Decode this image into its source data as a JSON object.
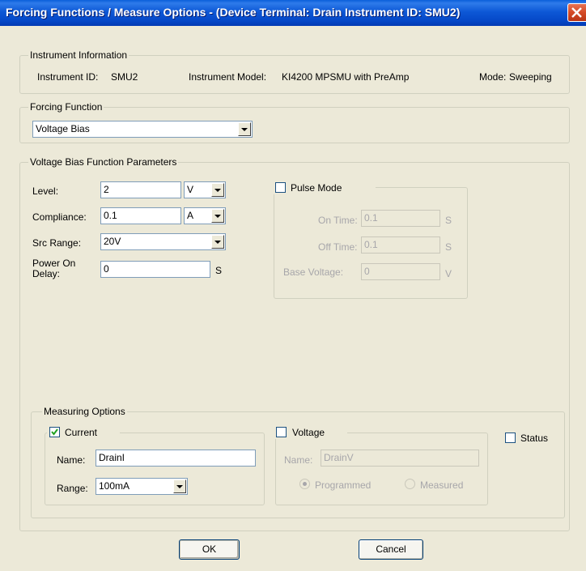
{
  "window": {
    "title": "Forcing Functions / Measure Options - (Device Terminal: Drain  Instrument ID: SMU2)"
  },
  "instrument_info": {
    "group_title": "Instrument Information",
    "id_label": "Instrument ID:",
    "id_value": "SMU2",
    "model_label": "Instrument Model:",
    "model_value": "KI4200 MPSMU with PreAmp",
    "mode_label": "Mode:",
    "mode_value": "Sweeping"
  },
  "forcing_function": {
    "group_title": "Forcing Function",
    "selected": "Voltage Bias"
  },
  "params": {
    "group_title": "Voltage Bias Function Parameters",
    "level_label": "Level:",
    "level_value": "2",
    "level_unit": "V",
    "compliance_label": "Compliance:",
    "compliance_value": "0.1",
    "compliance_unit": "A",
    "src_range_label": "Src Range:",
    "src_range_value": "20V",
    "power_on_delay_label_line1": "Power On",
    "power_on_delay_label_line2": "Delay:",
    "power_on_delay_value": "0",
    "power_on_delay_unit": "S"
  },
  "pulse": {
    "label": "Pulse Mode",
    "checked": false,
    "on_time_label": "On Time:",
    "on_time_value": "0.1",
    "on_time_unit": "S",
    "off_time_label": "Off Time:",
    "off_time_value": "0.1",
    "off_time_unit": "S",
    "base_voltage_label": "Base Voltage:",
    "base_voltage_value": "0",
    "base_voltage_unit": "V"
  },
  "measuring": {
    "group_title": "Measuring Options",
    "current": {
      "label": "Current",
      "checked": true,
      "name_label": "Name:",
      "name_value": "DrainI",
      "range_label": "Range:",
      "range_value": "100mA"
    },
    "voltage": {
      "label": "Voltage",
      "checked": false,
      "name_label": "Name:",
      "name_value": "DrainV",
      "programmed_label": "Programmed",
      "measured_label": "Measured",
      "selected": "Programmed"
    },
    "status": {
      "label": "Status",
      "checked": false
    }
  },
  "buttons": {
    "ok": "OK",
    "cancel": "Cancel"
  },
  "colors": {
    "titlebar": "#0548C8",
    "dialog_bg": "#ECE9D8",
    "close_button": "#D44A25",
    "disabled_text": "#A7A6AA"
  }
}
